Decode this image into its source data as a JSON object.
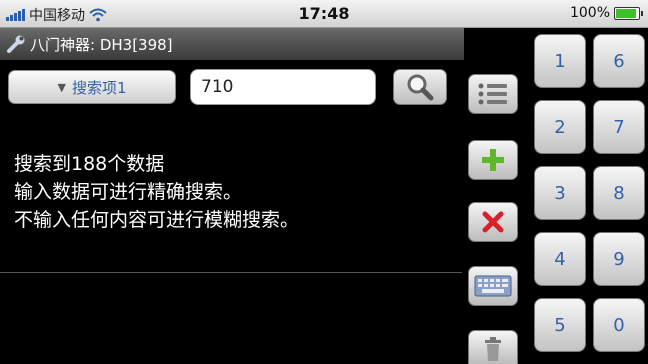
{
  "status_bar": {
    "carrier": "中国移动",
    "time": "17:48",
    "battery": "100%",
    "battery_level": 1.0
  },
  "title_bar": {
    "icon": "wrench-icon",
    "title": "八门神器: DH3[398]"
  },
  "search": {
    "dropdown_label": "搜索项1",
    "input_value": "710",
    "button_icon": "search-icon"
  },
  "result": {
    "line1": "搜索到188个数据",
    "line2": "输入数据可进行精确搜索。",
    "line3": "不输入任何内容可进行模糊搜索。"
  },
  "side_buttons": [
    {
      "icon": "list-icon"
    },
    {
      "icon": "add-icon",
      "color": "#5fb82a"
    },
    {
      "icon": "delete-icon",
      "color": "#d8202a"
    },
    {
      "icon": "keyboard-icon"
    },
    {
      "icon": "trash-icon"
    }
  ],
  "numpad": {
    "keys": [
      "1",
      "6",
      "2",
      "7",
      "3",
      "8",
      "4",
      "9",
      "5",
      "0"
    ]
  },
  "colors": {
    "accent_blue": "#3461a8",
    "add_green": "#5fb82a",
    "delete_red": "#d8202a"
  }
}
